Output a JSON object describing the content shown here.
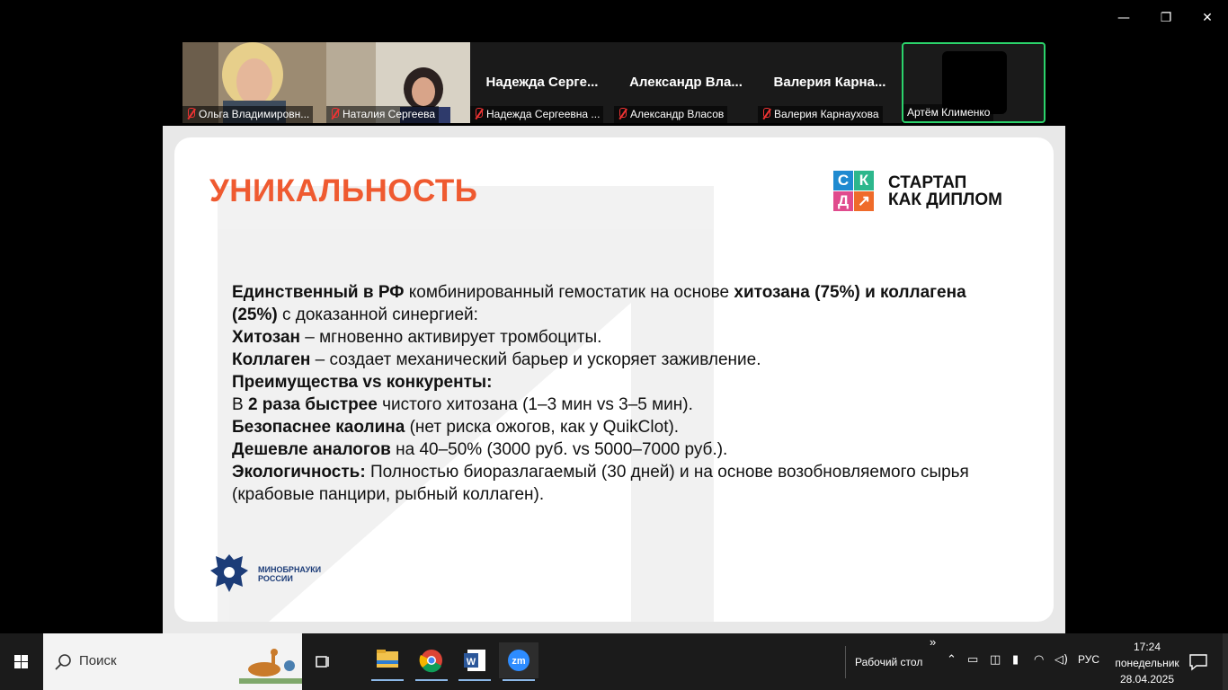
{
  "window_controls": {
    "minimize": "—",
    "restore": "❐",
    "close": "✕"
  },
  "participants": [
    {
      "id": "p1",
      "label": "Ольга Владимировн...",
      "video": true,
      "muted": true
    },
    {
      "id": "p2",
      "label": "Наталия Сергеева",
      "video": true,
      "muted": true
    },
    {
      "id": "p3",
      "name": "Надежда  Серге...",
      "label": "Надежда Сергеевна ...",
      "video": false,
      "muted": true
    },
    {
      "id": "p4",
      "name": "Александр  Вла...",
      "label": "Александр Власов",
      "video": false,
      "muted": true
    },
    {
      "id": "p5",
      "name": "Валерия  Карна...",
      "label": "Валерия Карнаухова",
      "video": false,
      "muted": true
    },
    {
      "id": "p6",
      "label": "Артём Клименко",
      "video": true,
      "muted": false,
      "active_speaker": true
    }
  ],
  "slide": {
    "title": "УНИКАЛЬНОСТЬ",
    "logo": {
      "letters": [
        "С",
        "К",
        "Д",
        "↗"
      ],
      "line1": "СТАРТАП",
      "line2": "КАК ДИПЛОМ"
    },
    "ministry": {
      "line1": "МИНОБРНАУКИ",
      "line2": "РОССИИ"
    },
    "p1": {
      "b1": "Единственный в РФ",
      "t1": " комбинированный гемостатик на основе ",
      "b2": "хитозана (75%) и коллагена (25%)",
      "t2": " с доказанной синергией:"
    },
    "p2": {
      "b": "Хитозан",
      "t": " – мгновенно активирует тромбоциты."
    },
    "p3": {
      "b": "Коллаген",
      "t": " – создает механический барьер и ускоряет заживление."
    },
    "p4": {
      "b": "Преимущества vs конкуренты:"
    },
    "p5": {
      "t0": "В ",
      "b": "2 раза быстрее",
      "t": " чистого хитозана (1–3 мин vs 3–5 мин)."
    },
    "p6": {
      "b": "Безопаснее каолина",
      "t": " (нет риска ожогов, как у QuikClot)."
    },
    "p7": {
      "b": "Дешевле аналогов",
      "t": " на 40–50% (3000 руб. vs 5000–7000 руб.)."
    },
    "p8": {
      "b": "Экологичность:",
      "t": " Полностью биоразлагаемый (30 дней) и на основе возобновляемого сырья (крабовые панцири, рыбный коллаген)."
    }
  },
  "taskbar": {
    "search_placeholder": "Поиск",
    "apps": [
      "file-explorer",
      "chrome",
      "word",
      "zoom"
    ],
    "desktop_label": "Рабочий стол",
    "overflow": "»",
    "language": "РУС",
    "time": "17:24",
    "weekday": "понедельник",
    "date": "28.04.2025"
  },
  "colors": {
    "accent": "#ef5a30",
    "active_speaker": "#2bd36b",
    "taskbar": "#1b1b1b"
  }
}
